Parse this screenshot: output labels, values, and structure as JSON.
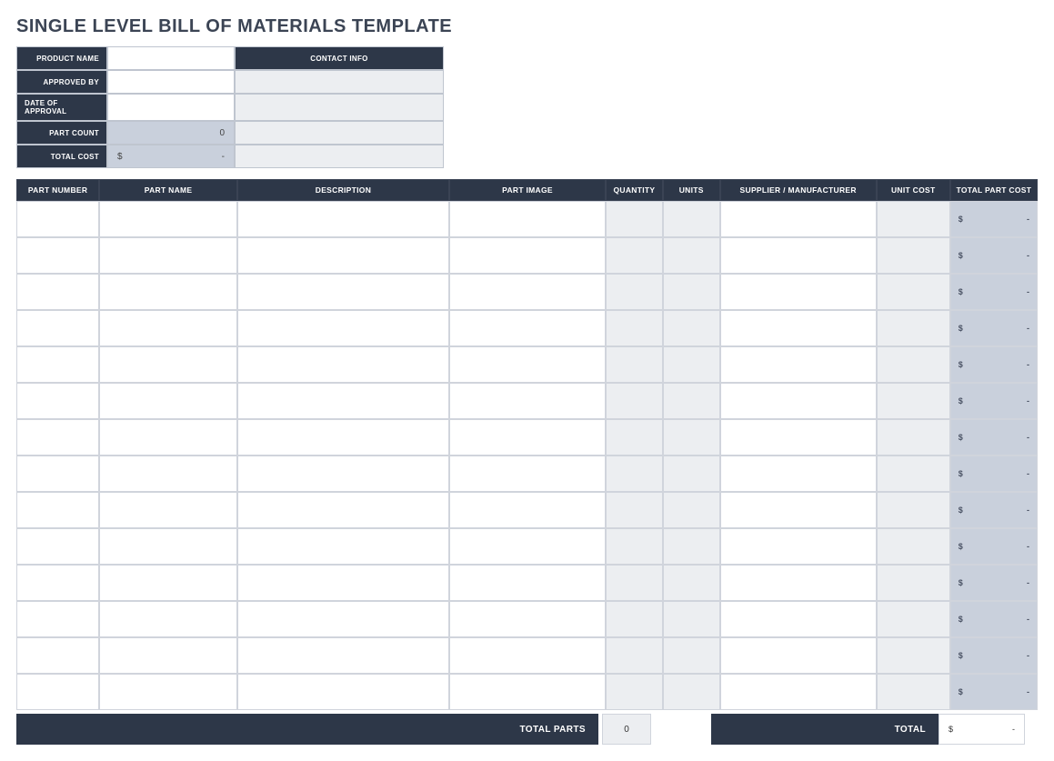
{
  "title": "SINGLE LEVEL BILL OF MATERIALS TEMPLATE",
  "summary": {
    "labels": {
      "product_name": "PRODUCT NAME",
      "approved_by": "APPROVED BY",
      "date_of_approval": "DATE OF APPROVAL",
      "part_count": "PART COUNT",
      "total_cost": "TOTAL COST",
      "contact_info": "CONTACT INFO"
    },
    "values": {
      "product_name": "",
      "approved_by": "",
      "date_of_approval": "",
      "part_count": "0",
      "total_cost_currency": "$",
      "total_cost_value": "-",
      "contact_product": "",
      "contact_approved": "",
      "contact_date": "",
      "contact_part": "",
      "contact_total": ""
    }
  },
  "columns": {
    "part_number": "PART NUMBER",
    "part_name": "PART NAME",
    "description": "DESCRIPTION",
    "part_image": "PART IMAGE",
    "quantity": "QUANTITY",
    "units": "UNITS",
    "supplier": "SUPPLIER / MANUFACTURER",
    "unit_cost": "UNIT COST",
    "total_part_cost": "TOTAL PART COST"
  },
  "rows": [
    {
      "total_currency": "$",
      "total_value": "-"
    },
    {
      "total_currency": "$",
      "total_value": "-"
    },
    {
      "total_currency": "$",
      "total_value": "-"
    },
    {
      "total_currency": "$",
      "total_value": "-"
    },
    {
      "total_currency": "$",
      "total_value": "-"
    },
    {
      "total_currency": "$",
      "total_value": "-"
    },
    {
      "total_currency": "$",
      "total_value": "-"
    },
    {
      "total_currency": "$",
      "total_value": "-"
    },
    {
      "total_currency": "$",
      "total_value": "-"
    },
    {
      "total_currency": "$",
      "total_value": "-"
    },
    {
      "total_currency": "$",
      "total_value": "-"
    },
    {
      "total_currency": "$",
      "total_value": "-"
    },
    {
      "total_currency": "$",
      "total_value": "-"
    },
    {
      "total_currency": "$",
      "total_value": "-"
    }
  ],
  "footer": {
    "total_parts_label": "TOTAL PARTS",
    "total_parts_value": "0",
    "total_label": "TOTAL",
    "total_currency": "$",
    "total_value": "-"
  }
}
